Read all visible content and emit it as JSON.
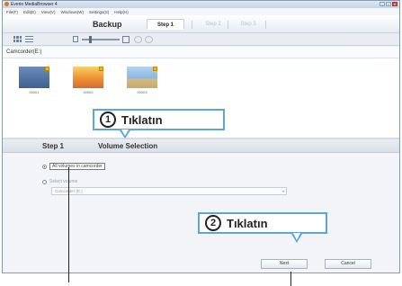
{
  "window": {
    "title": "Everio MediaBrowser 4",
    "controls": [
      "-",
      "▫",
      "x"
    ]
  },
  "menu": [
    "File(F)",
    "Edit(E)",
    "View(V)",
    "Windows(W)",
    "Settings(S)",
    "Help(H)"
  ],
  "steps_bar": {
    "mode_title": "Backup",
    "tabs": [
      "Step 1",
      "Step 2",
      "Step 3"
    ]
  },
  "device": {
    "label": "Camcorder(E:)"
  },
  "thumbnails": [
    {
      "name": "00001",
      "icon": "thumbnail-concert"
    },
    {
      "name": "00002",
      "icon": "thumbnail-airplane"
    },
    {
      "name": "00003",
      "icon": "thumbnail-pyramid"
    }
  ],
  "panel": {
    "step_label": "Step 1",
    "title": "Volume Selection",
    "radio_all_label": "All volumes in camcorder",
    "radio_select_label": "Select volume",
    "select_value": "Camcorder (E:)",
    "next_button": "Next",
    "cancel_button": "Cancel"
  },
  "callouts": [
    {
      "number": "1",
      "text": "Tıklatın"
    },
    {
      "number": "2",
      "text": "Tıklatın"
    }
  ],
  "colors": {
    "callout_border": "#5aa7d8",
    "window_border": "#8a9aae"
  }
}
